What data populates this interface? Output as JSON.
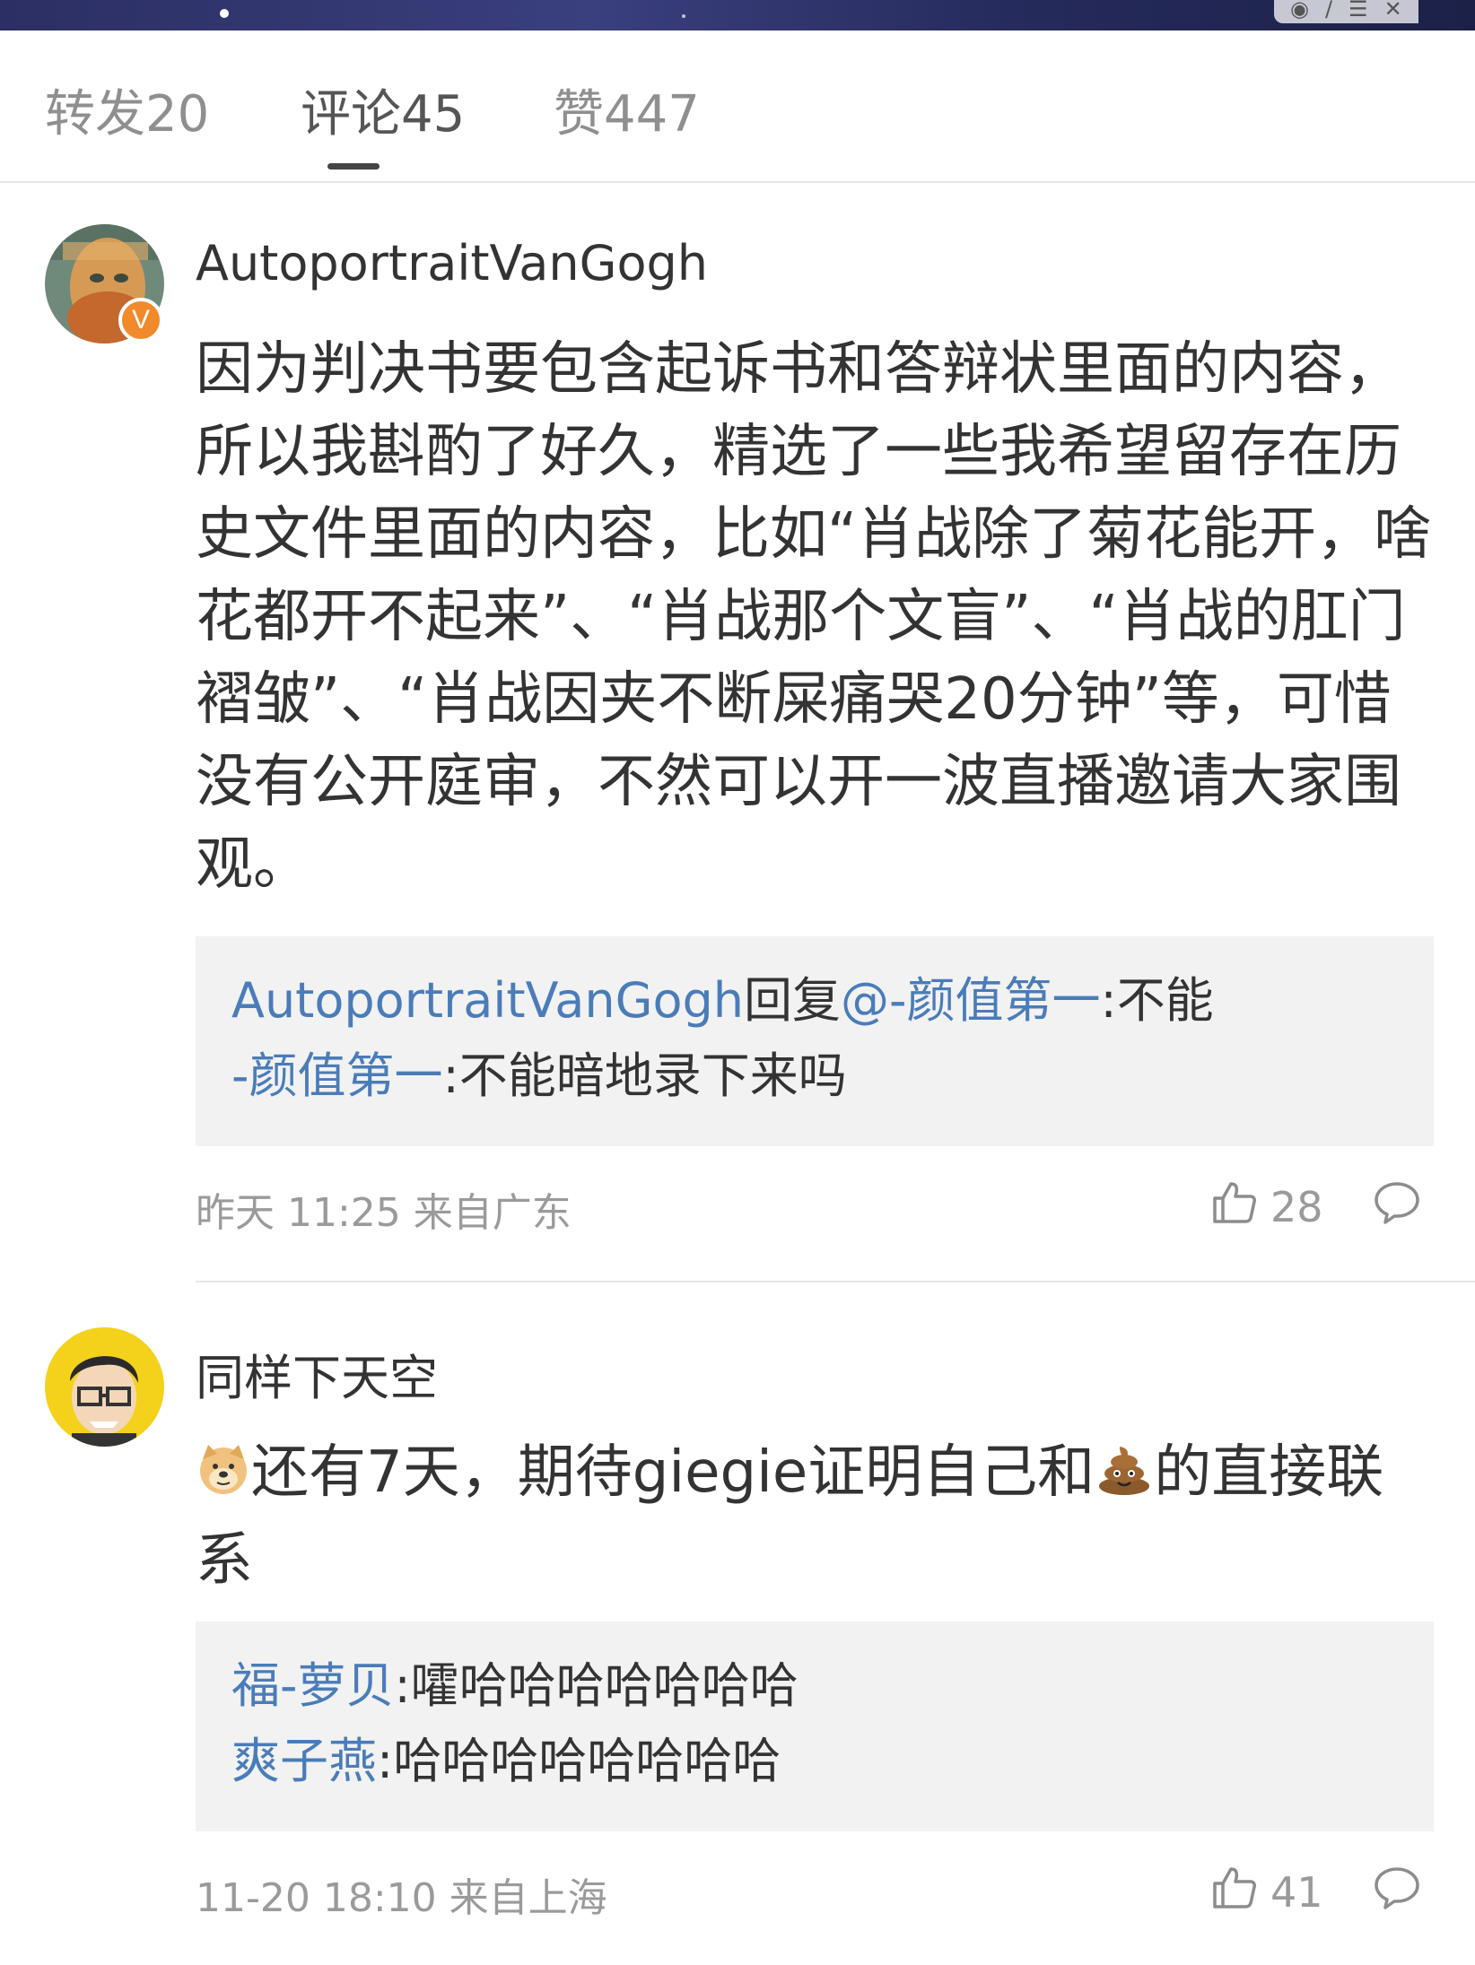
{
  "tabs": {
    "repost": "转发20",
    "comments": "评论45",
    "likes": "赞447"
  },
  "comments": [
    {
      "username": "AutoportraitVanGogh",
      "verified_badge": "V",
      "text": "因为判决书要包含起诉书和答辩状里面的内容，所以我斟酌了好久，精选了一些我希望留存在历史文件里面的内容，比如“肖战除了菊花能开，啥花都开不起来”、“肖战那个文盲”、“肖战的肛门褶皱”、“肖战因夹不断屎痛哭20分钟”等，可惜没有公开庭审，不然可以开一波直播邀请大家围观。",
      "replies": [
        {
          "author": "AutoportraitVanGogh",
          "reply_word": "回复",
          "mention": "@-颜值第一",
          "separator": ":",
          "text": "不能"
        },
        {
          "author": "-颜值第一",
          "separator": ":",
          "text": "不能暗地录下来吗"
        }
      ],
      "time": "昨天 11:25 来自广东",
      "likes": "28"
    },
    {
      "username": "同样下天空",
      "lead_emoji": "doge-emoji",
      "text_part1": "还有7天，期待giegie证明自己和",
      "inline_emoji": "poop-emoji",
      "text_part2": "的直接联系",
      "replies": [
        {
          "author": "福-萝贝",
          "separator": ":",
          "text": "嚯哈哈哈哈哈哈哈"
        },
        {
          "author": "爽子燕",
          "separator": ":",
          "text": "哈哈哈哈哈哈哈哈"
        }
      ],
      "time": "11-20 18:10 来自上海",
      "likes": "41"
    }
  ],
  "colors": {
    "link_blue": "#4a7cb8",
    "text": "#333333",
    "meta_gray": "#9a9a9a",
    "reply_bg": "#f2f2f2",
    "verified_orange": "#f08a2a"
  }
}
